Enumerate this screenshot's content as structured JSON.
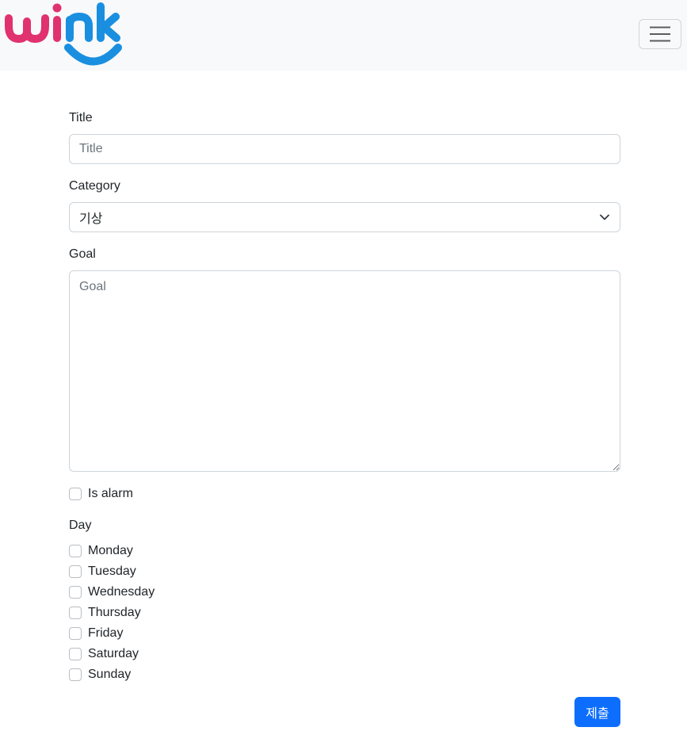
{
  "navbar": {
    "logo_text": "wink",
    "logo_colors": {
      "pink": "#e0326e",
      "blue": "#1a8fe0"
    },
    "toggler_icon": "hamburger-icon"
  },
  "form": {
    "title": {
      "label": "Title",
      "placeholder": "Title",
      "value": ""
    },
    "category": {
      "label": "Category",
      "selected": "기상",
      "icon": "chevron-down-icon"
    },
    "goal": {
      "label": "Goal",
      "placeholder": "Goal",
      "value": ""
    },
    "alarm": {
      "label": "Is alarm",
      "checked": false
    },
    "day": {
      "label": "Day",
      "options": [
        {
          "label": "Monday",
          "checked": false
        },
        {
          "label": "Tuesday",
          "checked": false
        },
        {
          "label": "Wednesday",
          "checked": false
        },
        {
          "label": "Thursday",
          "checked": false
        },
        {
          "label": "Friday",
          "checked": false
        },
        {
          "label": "Saturday",
          "checked": false
        },
        {
          "label": "Sunday",
          "checked": false
        }
      ]
    },
    "submit_label": "제출"
  },
  "colors": {
    "primary": "#0d6efd",
    "navbar_bg": "#f8f9fa",
    "border": "#ced4da"
  }
}
